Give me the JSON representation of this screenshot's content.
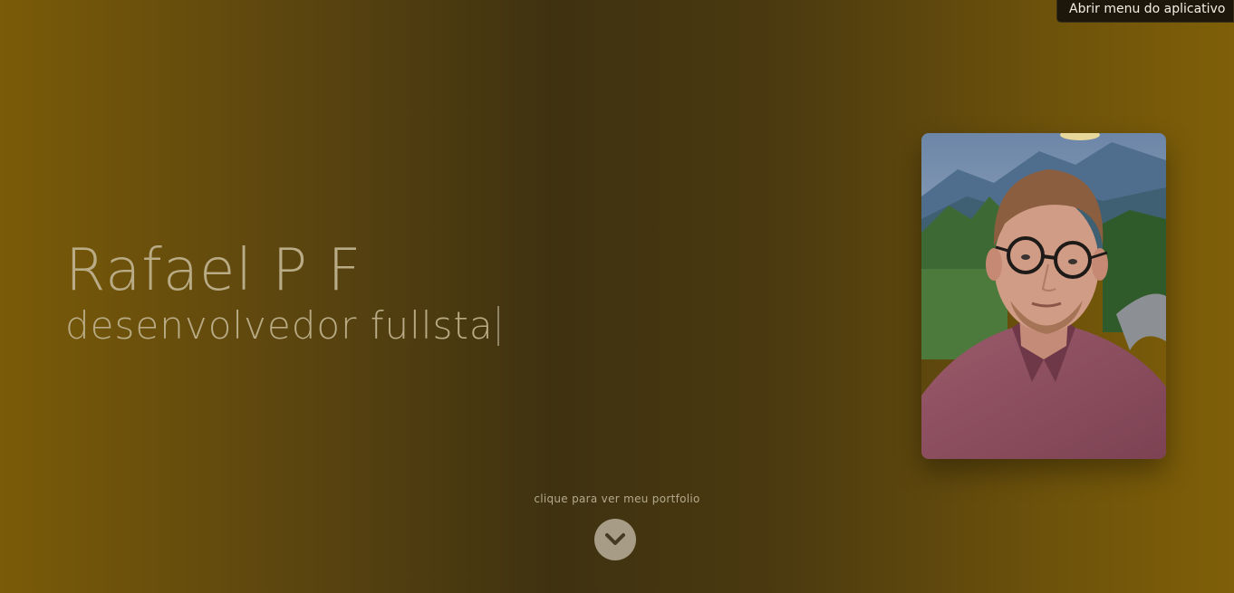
{
  "header": {
    "menu_button_label": "Abrir menu do aplicativo"
  },
  "hero": {
    "name": "Rafael P F",
    "role": "desenvolvedor fullsta",
    "cta_text": "clique para ver meu portfolio",
    "scroll_icon": "chevron-down-icon"
  },
  "colors": {
    "gradient_edge": "#7a5b08",
    "gradient_center": "#3f3211",
    "heading_text": "#b8ab85",
    "menu_background": "#1d160a",
    "scroll_button": "#a79d86"
  }
}
